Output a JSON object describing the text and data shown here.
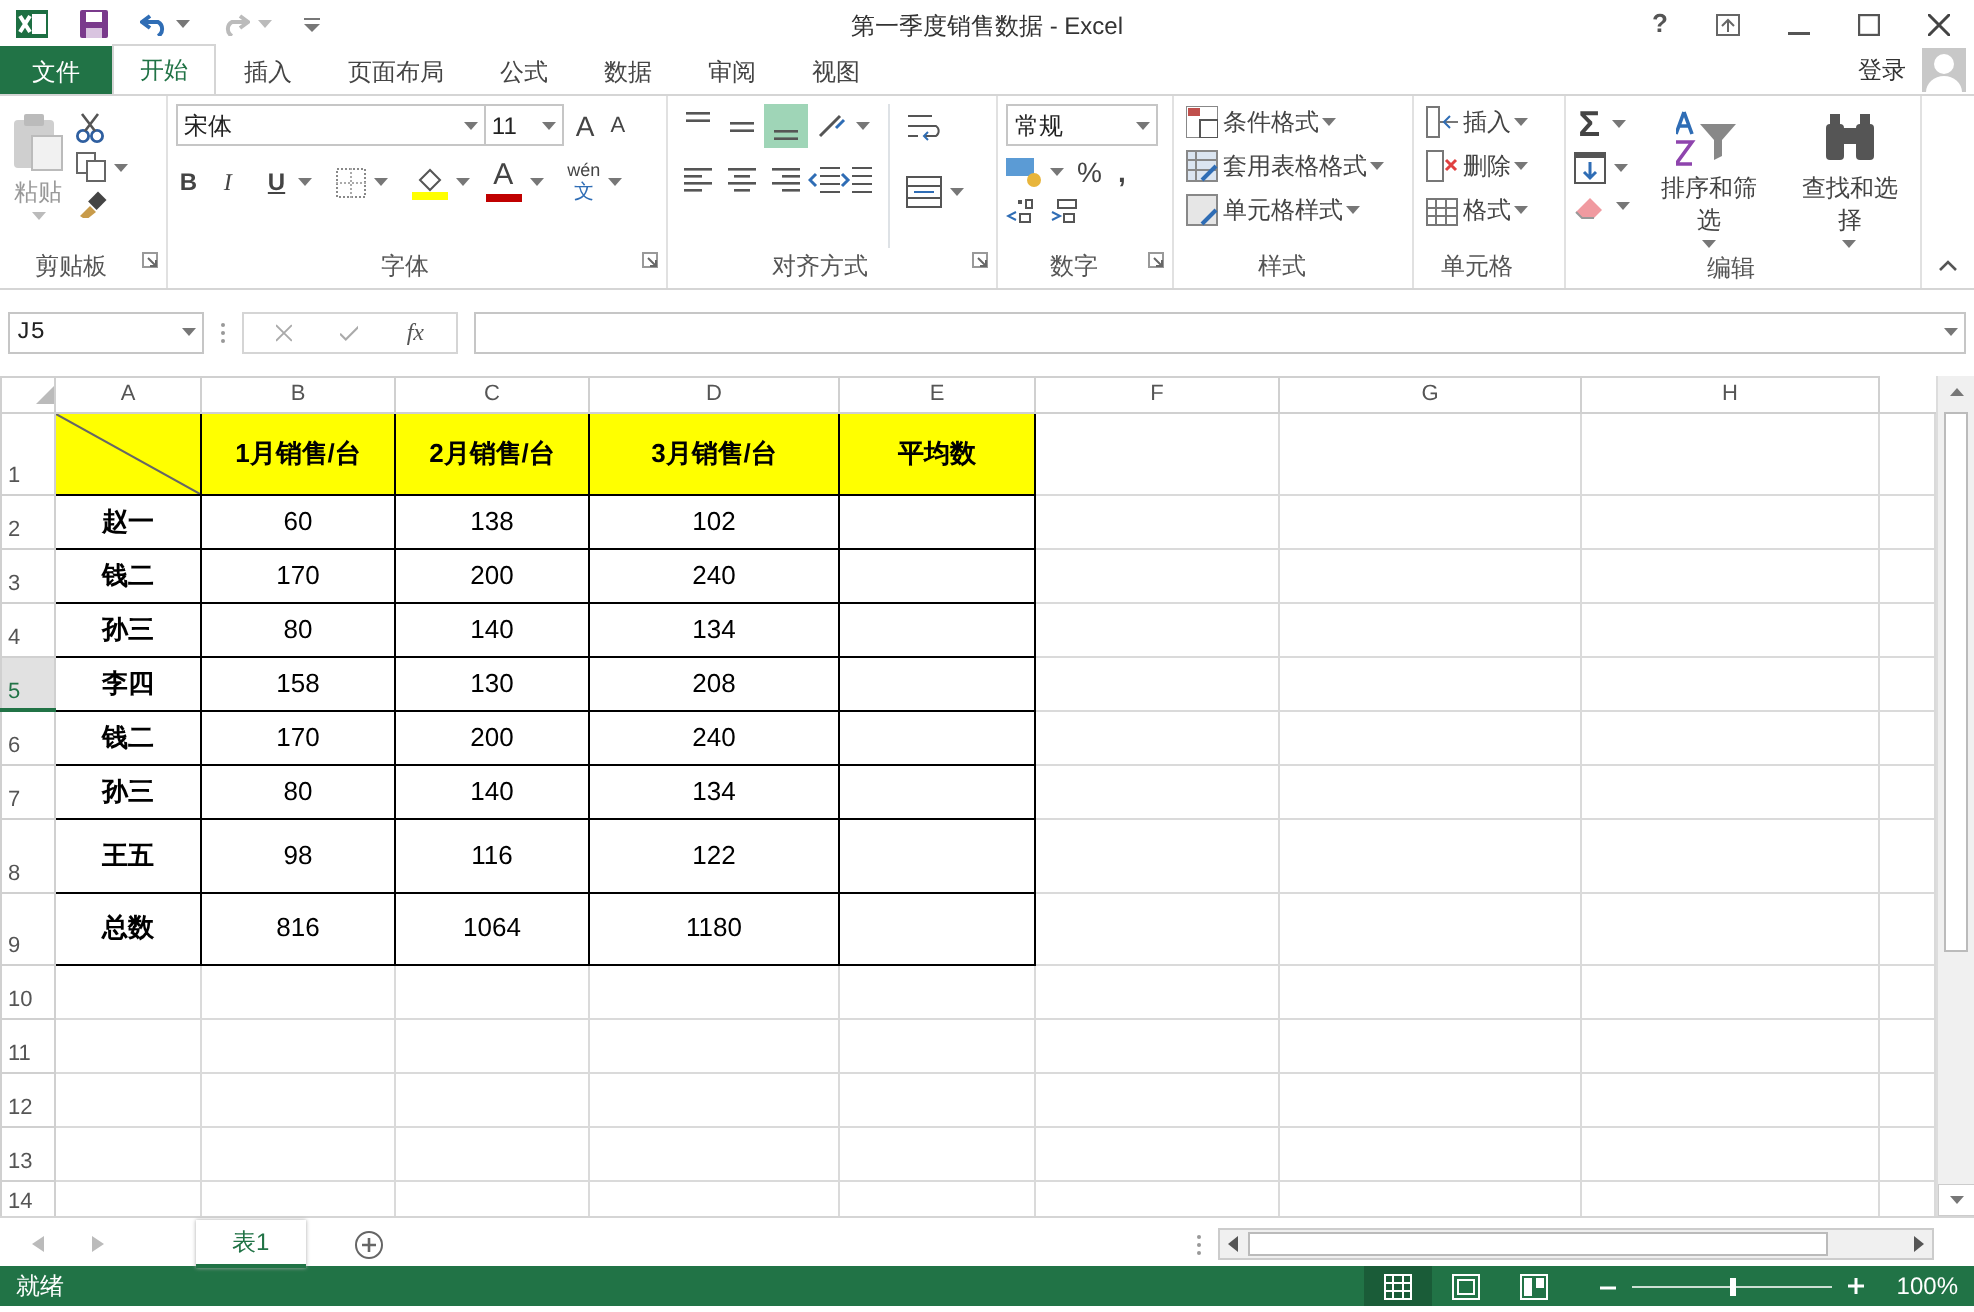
{
  "window": {
    "title": "第一季度销售数据 - Excel",
    "help": "?"
  },
  "tabs": [
    {
      "label": "文件",
      "kind": "file",
      "selected": false
    },
    {
      "label": "开始",
      "kind": "tab",
      "selected": true
    },
    {
      "label": "插入",
      "kind": "tab",
      "selected": false
    },
    {
      "label": "页面布局",
      "kind": "tab",
      "selected": false
    },
    {
      "label": "公式",
      "kind": "tab",
      "selected": false
    },
    {
      "label": "数据",
      "kind": "tab",
      "selected": false
    },
    {
      "label": "审阅",
      "kind": "tab",
      "selected": false
    },
    {
      "label": "视图",
      "kind": "tab",
      "selected": false
    }
  ],
  "account": {
    "label": "登录"
  },
  "ribbon": {
    "clipboard": {
      "paste": "粘贴",
      "label": "剪贴板"
    },
    "font": {
      "name": "宋体",
      "size": "11",
      "grow": "A",
      "shrink": "A",
      "bold": "B",
      "italic": "I",
      "underline": "U",
      "color_letter": "A",
      "phonetic_top": "wén",
      "phonetic_bottom": "文",
      "label": "字体"
    },
    "alignment": {
      "vertical": [
        {
          "selected": false
        },
        {
          "selected": false
        },
        {
          "selected": true
        }
      ],
      "horizontal": [
        {
          "selected": false
        },
        {
          "selected": false
        },
        {
          "selected": false
        }
      ],
      "label": "对齐方式"
    },
    "number": {
      "format": "常规",
      "percent": "%",
      "comma": ",",
      "label": "数字"
    },
    "styles": {
      "items": [
        "条件格式",
        "套用表格格式",
        "单元格样式"
      ],
      "label": "样式"
    },
    "cells": {
      "items": [
        "插入",
        "删除",
        "格式"
      ],
      "label": "单元格"
    },
    "editing": {
      "sum": "Σ",
      "sort": "排序和筛选",
      "find": "查找和选择",
      "label": "编辑"
    }
  },
  "formula_bar": {
    "name_box": "J5",
    "fx": "fx"
  },
  "sheet": {
    "columns": [
      "A",
      "B",
      "C",
      "D",
      "E",
      "F",
      "G",
      "H"
    ],
    "rows": [
      {
        "number": "1",
        "kind": "header",
        "selected": false,
        "cells": [
          {
            "diagonal": true
          },
          {
            "text": "1月销售/台"
          },
          {
            "text": "2月销售/台"
          },
          {
            "text": "3月销售/台"
          },
          {
            "text": "平均数"
          }
        ]
      },
      {
        "number": "2",
        "kind": "data",
        "selected": false,
        "cells": [
          {
            "text": "赵一"
          },
          {
            "text": "60"
          },
          {
            "text": "138"
          },
          {
            "text": "102"
          }
        ]
      },
      {
        "number": "3",
        "kind": "data",
        "selected": false,
        "cells": [
          {
            "text": "钱二"
          },
          {
            "text": "170"
          },
          {
            "text": "200"
          },
          {
            "text": "240"
          }
        ]
      },
      {
        "number": "4",
        "kind": "data",
        "selected": false,
        "cells": [
          {
            "text": "孙三"
          },
          {
            "text": "80"
          },
          {
            "text": "140"
          },
          {
            "text": "134"
          }
        ]
      },
      {
        "number": "5",
        "kind": "data",
        "selected": true,
        "cells": [
          {
            "text": "李四"
          },
          {
            "text": "158"
          },
          {
            "text": "130"
          },
          {
            "text": "208"
          }
        ]
      },
      {
        "number": "6",
        "kind": "data",
        "selected": false,
        "cells": [
          {
            "text": "钱二"
          },
          {
            "text": "170"
          },
          {
            "text": "200"
          },
          {
            "text": "240"
          }
        ]
      },
      {
        "number": "7",
        "kind": "data",
        "selected": false,
        "cells": [
          {
            "text": "孙三"
          },
          {
            "text": "80"
          },
          {
            "text": "140"
          },
          {
            "text": "134"
          }
        ]
      },
      {
        "number": "8",
        "kind": "data",
        "selected": false,
        "cells": [
          {
            "text": "王五"
          },
          {
            "text": "98"
          },
          {
            "text": "116"
          },
          {
            "text": "122"
          }
        ]
      },
      {
        "number": "9",
        "kind": "data",
        "selected": false,
        "cells": [
          {
            "text": "总数"
          },
          {
            "text": "816"
          },
          {
            "text": "1064"
          },
          {
            "text": "1180"
          }
        ]
      },
      {
        "number": "10",
        "kind": "empty",
        "selected": false
      },
      {
        "number": "11",
        "kind": "empty",
        "selected": false
      },
      {
        "number": "12",
        "kind": "empty",
        "selected": false
      },
      {
        "number": "13",
        "kind": "empty",
        "selected": false
      },
      {
        "number": "14",
        "kind": "empty",
        "selected": false
      }
    ]
  },
  "sheet_tabs": [
    {
      "label": "表1",
      "selected": true
    }
  ],
  "status_bar": {
    "text": "就绪",
    "views": [
      {
        "kind": "normal",
        "selected": true
      },
      {
        "kind": "layout",
        "selected": false
      },
      {
        "kind": "break",
        "selected": false
      }
    ],
    "zoom": {
      "level": 0.5
    },
    "zoom_text": "100%"
  }
}
